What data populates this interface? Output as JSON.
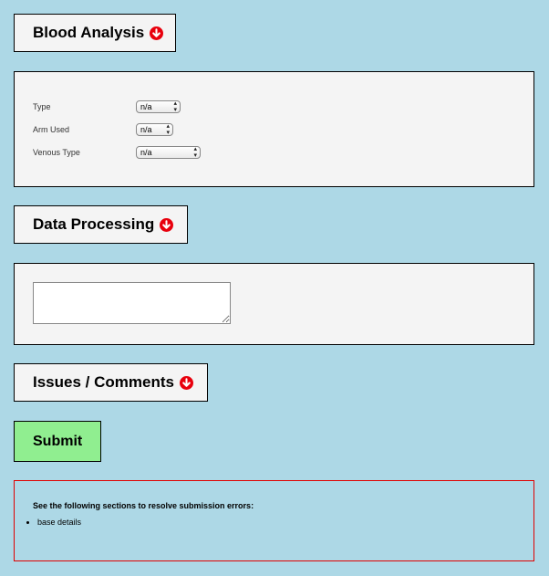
{
  "colors": {
    "background": "#add8e6",
    "panel": "#f4f4f4",
    "submit": "#90ee90",
    "error_border": "#e00000",
    "arrow_icon": "#e8000d"
  },
  "sections": {
    "blood_analysis": {
      "title": "Blood Analysis",
      "icon": "arrow-down-circle-icon",
      "fields": [
        {
          "label": "Type",
          "value": "n/a"
        },
        {
          "label": "Arm Used",
          "value": "n/a"
        },
        {
          "label": "Venous Type",
          "value": "n/a"
        }
      ]
    },
    "data_processing": {
      "title": "Data Processing",
      "icon": "arrow-down-circle-icon",
      "textarea_value": ""
    },
    "issues_comments": {
      "title": "Issues / Comments",
      "icon": "arrow-down-circle-icon"
    }
  },
  "submit_label": "Submit",
  "errors": {
    "title": "See the following sections to resolve submission errors:",
    "items": [
      "base details"
    ]
  }
}
